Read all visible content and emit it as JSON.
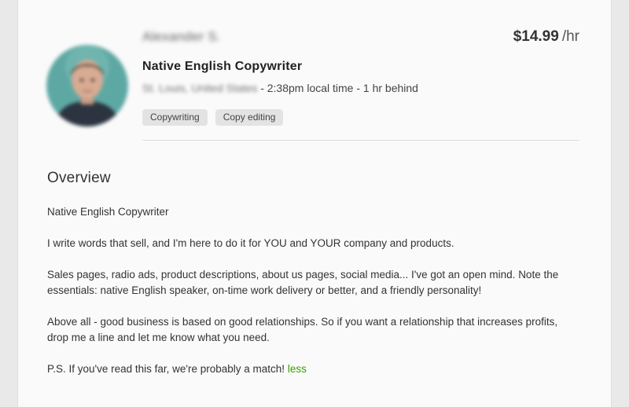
{
  "profile": {
    "name": "Alexander S.",
    "title": "Native English Copywriter",
    "location": "St. Louis, United States",
    "time_info": " - 2:38pm local time - 1 hr behind",
    "rate_amount": "$14.99",
    "rate_unit": "/hr",
    "skills": [
      "Copywriting",
      "Copy editing"
    ]
  },
  "overview": {
    "heading": "Overview",
    "paragraphs": [
      "Native English Copywriter",
      "I write words that sell, and I'm here to do it for YOU and YOUR company and products.",
      "Sales pages, radio ads, product descriptions, about us pages, social media... I've got an open mind. Note the essentials: native English speaker, on-time work delivery or better, and a friendly personality!",
      "Above all - good business is based on good relationships. So if you want a relationship that increases profits, drop me a line and let me know what you need.",
      "P.S. If you've read this far, we're probably a match! "
    ],
    "less_link": "less"
  },
  "colors": {
    "link": "#37a000",
    "chip_bg": "#e3e3e3",
    "card_bg": "#fafafa"
  }
}
